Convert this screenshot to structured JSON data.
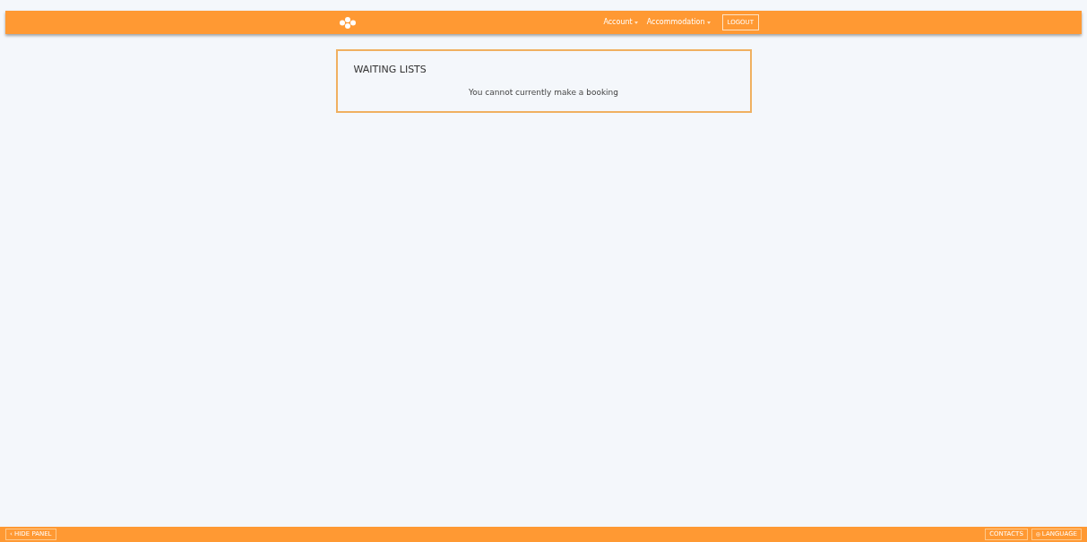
{
  "navbar": {
    "menus": [
      {
        "label": "Account"
      },
      {
        "label": "Accommodation"
      }
    ],
    "logout": "LOGOUT"
  },
  "panel": {
    "title": "WAITING LISTS",
    "message": "You cannot currently make a booking"
  },
  "footer": {
    "hide_panel": "‹ HIDE PANEL",
    "contacts": "CONTACTS",
    "language": "LANGUAGE"
  }
}
